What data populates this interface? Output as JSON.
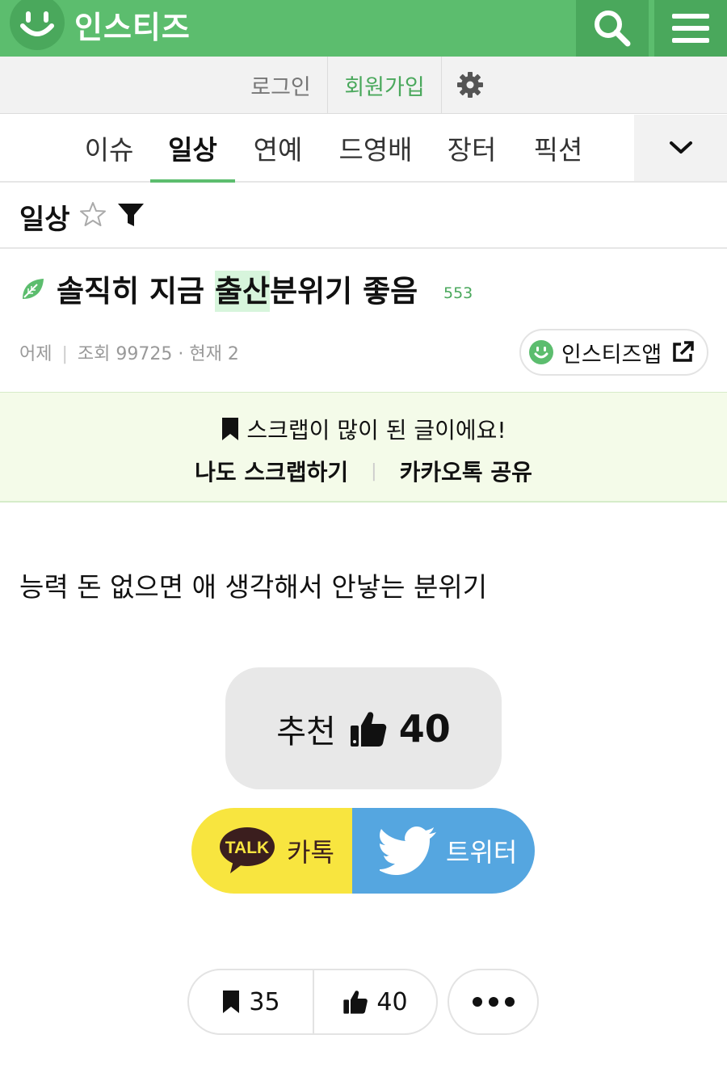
{
  "header": {
    "brand": "인스티즈",
    "brand_color": "#5cbd6e"
  },
  "account": {
    "login_label": "로그인",
    "join_label": "회원가입"
  },
  "categories": {
    "tabs": [
      "이슈",
      "일상",
      "연예",
      "드영배",
      "장터",
      "픽션"
    ],
    "active": "일상"
  },
  "board": {
    "title": "일상"
  },
  "post": {
    "title_pre": "솔직히 지금 ",
    "title_highlight": "출산",
    "title_post": "분위기 좋음",
    "comment_count": "553",
    "date": "어제",
    "views": "조회 99725 · 현재 2",
    "app_button": "인스티즈앱",
    "body": "능력 돈 없으면 애 생각해서 안낳는 분위기"
  },
  "scrap_banner": {
    "message": "스크랩이 많이 된 글이에요!",
    "scrap_action": "나도 스크랩하기",
    "kakao_share": "카카오톡 공유"
  },
  "recommend": {
    "label": "추천",
    "count": "40"
  },
  "share": {
    "kakao_badge": "TALK",
    "kakao_label": "카톡",
    "twitter_label": "트위터"
  },
  "actions": {
    "scrap_count": "35",
    "like_count": "40"
  }
}
